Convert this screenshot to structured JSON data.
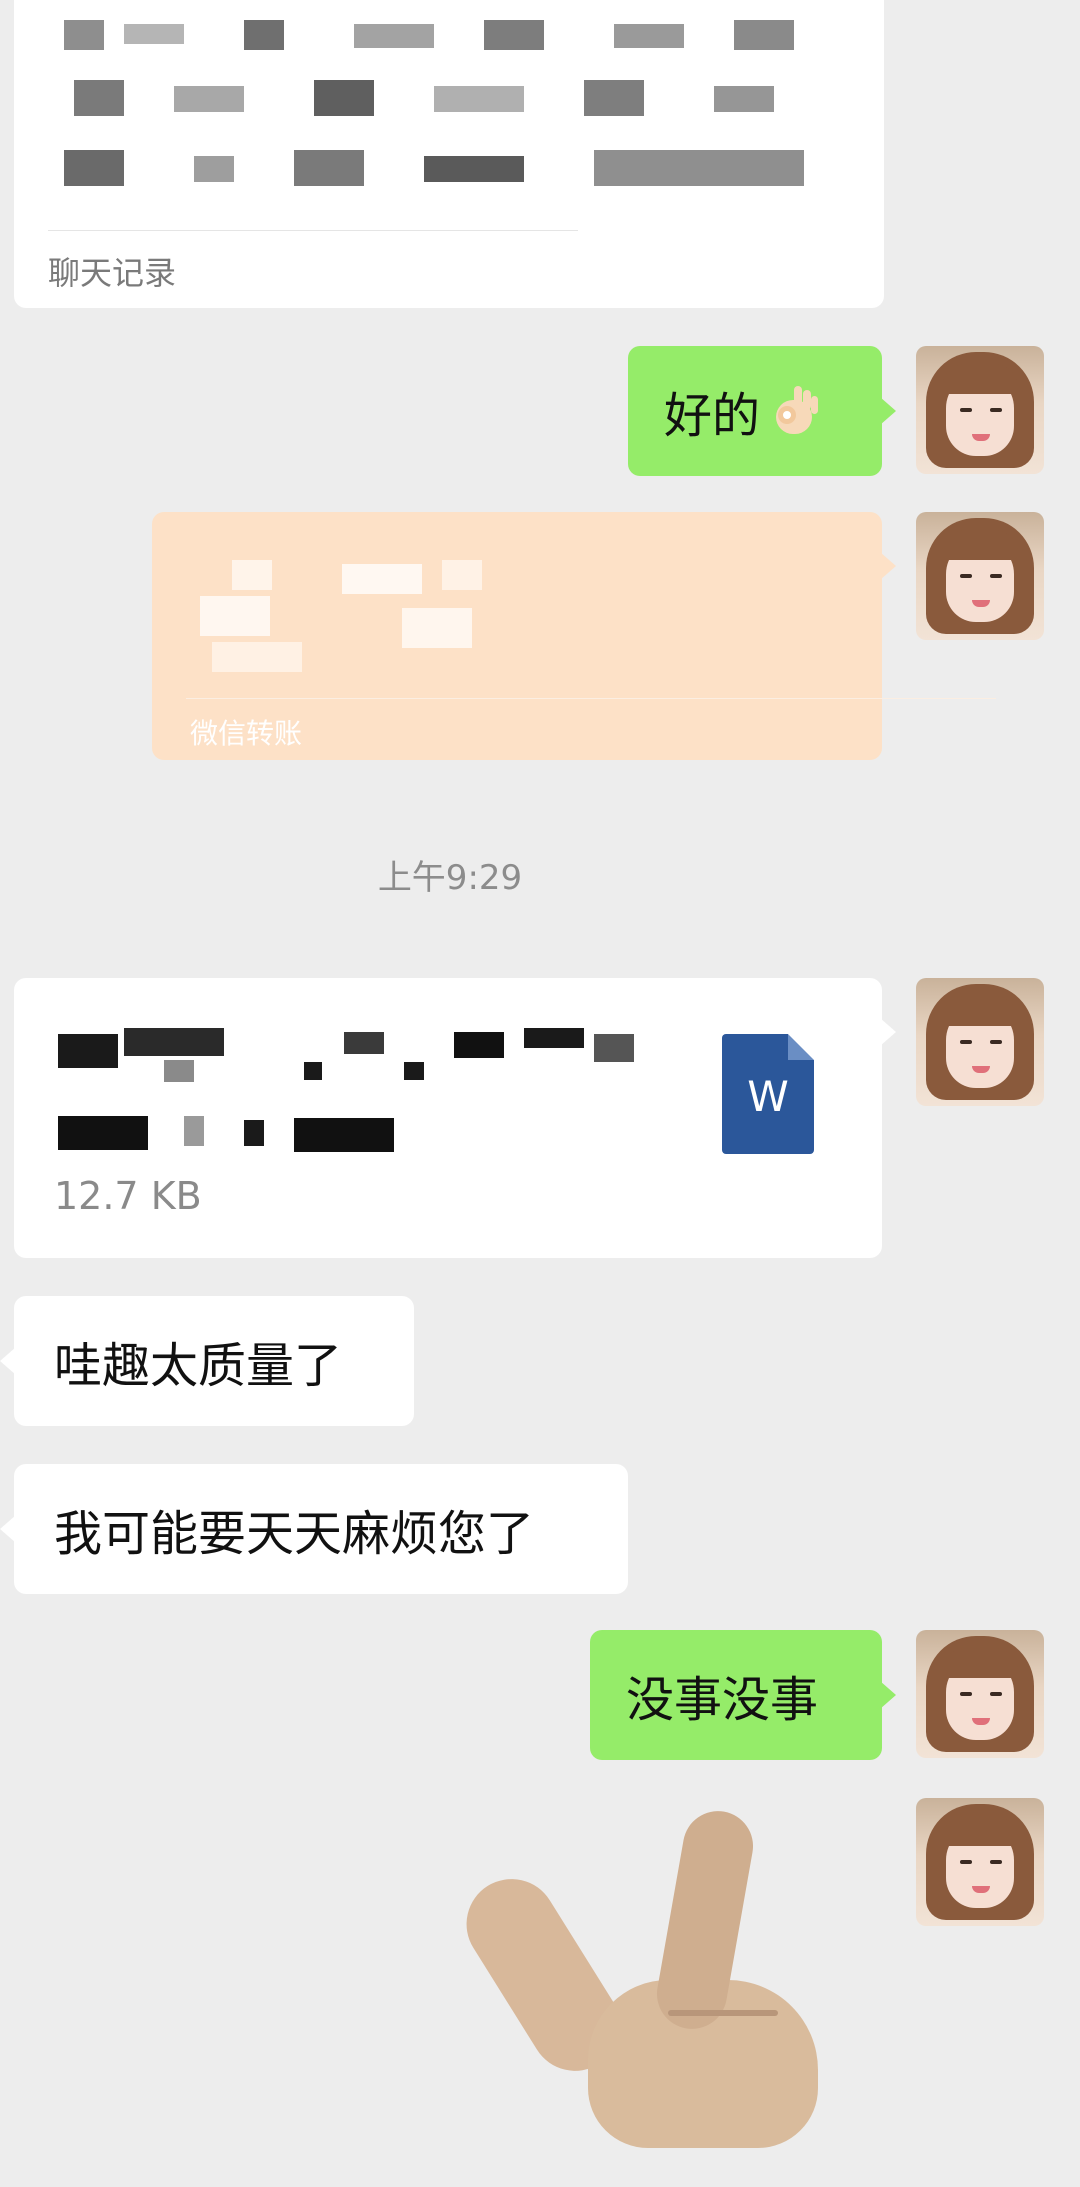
{
  "history_card": {
    "label": "聊天记录"
  },
  "messages": {
    "ok_text": "好的",
    "ok_emoji": "ok-hand-icon",
    "transfer_label": "微信转账",
    "timestamp": "上午9:29",
    "file_size": "12.7 KB",
    "file_icon_letter": "W",
    "reply1": "哇趣太质量了",
    "reply2": "我可能要天天麻烦您了",
    "reply3": "没事没事"
  },
  "colors": {
    "background": "#ededed",
    "self_bubble": "#95ec69",
    "other_bubble": "#ffffff",
    "transfer_card": "#fde1c7",
    "word_blue": "#2b579a"
  }
}
